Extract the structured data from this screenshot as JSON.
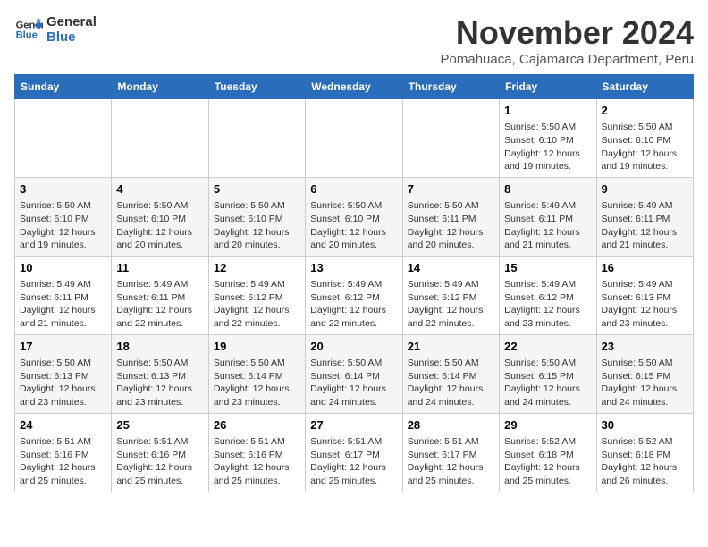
{
  "logo": {
    "line1": "General",
    "line2": "Blue"
  },
  "title": "November 2024",
  "subtitle": "Pomahuaca, Cajamarca Department, Peru",
  "weekdays": [
    "Sunday",
    "Monday",
    "Tuesday",
    "Wednesday",
    "Thursday",
    "Friday",
    "Saturday"
  ],
  "weeks": [
    [
      {
        "day": "",
        "info": ""
      },
      {
        "day": "",
        "info": ""
      },
      {
        "day": "",
        "info": ""
      },
      {
        "day": "",
        "info": ""
      },
      {
        "day": "",
        "info": ""
      },
      {
        "day": "1",
        "info": "Sunrise: 5:50 AM\nSunset: 6:10 PM\nDaylight: 12 hours and 19 minutes."
      },
      {
        "day": "2",
        "info": "Sunrise: 5:50 AM\nSunset: 6:10 PM\nDaylight: 12 hours and 19 minutes."
      }
    ],
    [
      {
        "day": "3",
        "info": "Sunrise: 5:50 AM\nSunset: 6:10 PM\nDaylight: 12 hours and 19 minutes."
      },
      {
        "day": "4",
        "info": "Sunrise: 5:50 AM\nSunset: 6:10 PM\nDaylight: 12 hours and 20 minutes."
      },
      {
        "day": "5",
        "info": "Sunrise: 5:50 AM\nSunset: 6:10 PM\nDaylight: 12 hours and 20 minutes."
      },
      {
        "day": "6",
        "info": "Sunrise: 5:50 AM\nSunset: 6:10 PM\nDaylight: 12 hours and 20 minutes."
      },
      {
        "day": "7",
        "info": "Sunrise: 5:50 AM\nSunset: 6:11 PM\nDaylight: 12 hours and 20 minutes."
      },
      {
        "day": "8",
        "info": "Sunrise: 5:49 AM\nSunset: 6:11 PM\nDaylight: 12 hours and 21 minutes."
      },
      {
        "day": "9",
        "info": "Sunrise: 5:49 AM\nSunset: 6:11 PM\nDaylight: 12 hours and 21 minutes."
      }
    ],
    [
      {
        "day": "10",
        "info": "Sunrise: 5:49 AM\nSunset: 6:11 PM\nDaylight: 12 hours and 21 minutes."
      },
      {
        "day": "11",
        "info": "Sunrise: 5:49 AM\nSunset: 6:11 PM\nDaylight: 12 hours and 22 minutes."
      },
      {
        "day": "12",
        "info": "Sunrise: 5:49 AM\nSunset: 6:12 PM\nDaylight: 12 hours and 22 minutes."
      },
      {
        "day": "13",
        "info": "Sunrise: 5:49 AM\nSunset: 6:12 PM\nDaylight: 12 hours and 22 minutes."
      },
      {
        "day": "14",
        "info": "Sunrise: 5:49 AM\nSunset: 6:12 PM\nDaylight: 12 hours and 22 minutes."
      },
      {
        "day": "15",
        "info": "Sunrise: 5:49 AM\nSunset: 6:12 PM\nDaylight: 12 hours and 23 minutes."
      },
      {
        "day": "16",
        "info": "Sunrise: 5:49 AM\nSunset: 6:13 PM\nDaylight: 12 hours and 23 minutes."
      }
    ],
    [
      {
        "day": "17",
        "info": "Sunrise: 5:50 AM\nSunset: 6:13 PM\nDaylight: 12 hours and 23 minutes."
      },
      {
        "day": "18",
        "info": "Sunrise: 5:50 AM\nSunset: 6:13 PM\nDaylight: 12 hours and 23 minutes."
      },
      {
        "day": "19",
        "info": "Sunrise: 5:50 AM\nSunset: 6:14 PM\nDaylight: 12 hours and 23 minutes."
      },
      {
        "day": "20",
        "info": "Sunrise: 5:50 AM\nSunset: 6:14 PM\nDaylight: 12 hours and 24 minutes."
      },
      {
        "day": "21",
        "info": "Sunrise: 5:50 AM\nSunset: 6:14 PM\nDaylight: 12 hours and 24 minutes."
      },
      {
        "day": "22",
        "info": "Sunrise: 5:50 AM\nSunset: 6:15 PM\nDaylight: 12 hours and 24 minutes."
      },
      {
        "day": "23",
        "info": "Sunrise: 5:50 AM\nSunset: 6:15 PM\nDaylight: 12 hours and 24 minutes."
      }
    ],
    [
      {
        "day": "24",
        "info": "Sunrise: 5:51 AM\nSunset: 6:16 PM\nDaylight: 12 hours and 25 minutes."
      },
      {
        "day": "25",
        "info": "Sunrise: 5:51 AM\nSunset: 6:16 PM\nDaylight: 12 hours and 25 minutes."
      },
      {
        "day": "26",
        "info": "Sunrise: 5:51 AM\nSunset: 6:16 PM\nDaylight: 12 hours and 25 minutes."
      },
      {
        "day": "27",
        "info": "Sunrise: 5:51 AM\nSunset: 6:17 PM\nDaylight: 12 hours and 25 minutes."
      },
      {
        "day": "28",
        "info": "Sunrise: 5:51 AM\nSunset: 6:17 PM\nDaylight: 12 hours and 25 minutes."
      },
      {
        "day": "29",
        "info": "Sunrise: 5:52 AM\nSunset: 6:18 PM\nDaylight: 12 hours and 25 minutes."
      },
      {
        "day": "30",
        "info": "Sunrise: 5:52 AM\nSunset: 6:18 PM\nDaylight: 12 hours and 26 minutes."
      }
    ]
  ]
}
